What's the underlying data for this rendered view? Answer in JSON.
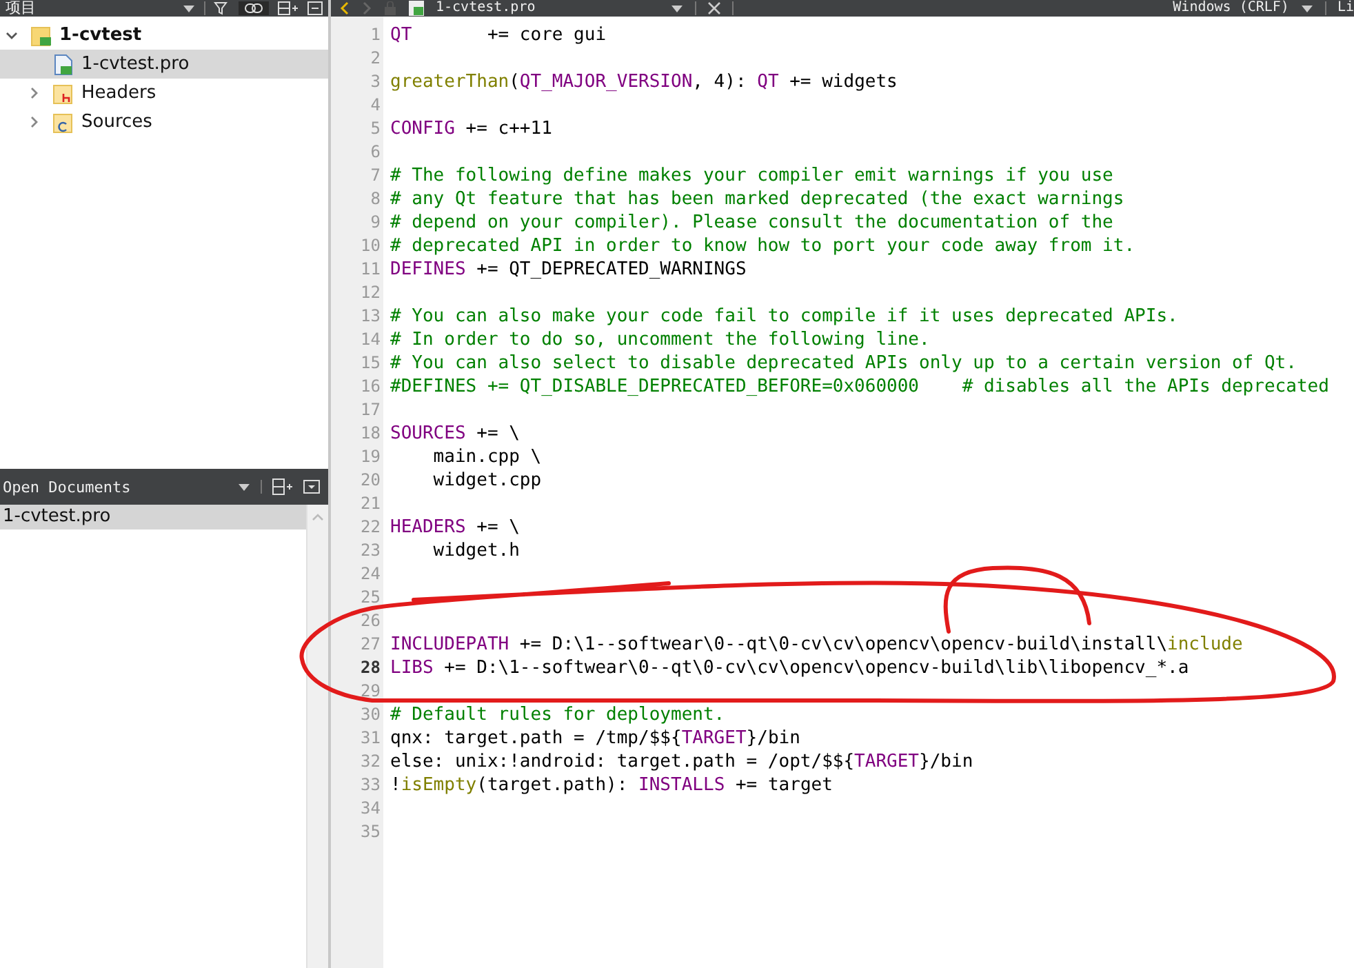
{
  "sidebar": {
    "title": "项目",
    "tree": [
      {
        "label": "1-cvtest",
        "kind": "project",
        "expanded": true,
        "selected": false,
        "children": [
          {
            "label": "1-cvtest.pro",
            "kind": "pro-file",
            "selected": true
          },
          {
            "label": "Headers",
            "kind": "headers",
            "expanded": false,
            "selected": false
          },
          {
            "label": "Sources",
            "kind": "sources",
            "expanded": false,
            "selected": false
          }
        ]
      }
    ]
  },
  "open_documents": {
    "title": "Open Documents",
    "items": [
      {
        "label": "1-cvtest.pro",
        "selected": true
      }
    ]
  },
  "editor": {
    "tab_title": "1-cvtest.pro",
    "line_ending": "Windows (CRLF)",
    "next_label": "Li",
    "lines": [
      {
        "number": "1",
        "current": false,
        "tokens": [
          {
            "kind": "keyword",
            "text": "QT"
          },
          {
            "kind": "plain",
            "text": "       += core gui"
          }
        ]
      },
      {
        "number": "2",
        "current": false
      },
      {
        "number": "3",
        "current": false,
        "tokens": [
          {
            "kind": "function",
            "text": "greaterThan"
          },
          {
            "kind": "plain",
            "text": "("
          },
          {
            "kind": "keyword",
            "text": "QT_MAJOR_VERSION"
          },
          {
            "kind": "plain",
            "text": ", 4): "
          },
          {
            "kind": "keyword",
            "text": "QT"
          },
          {
            "kind": "plain",
            "text": " += widgets"
          }
        ]
      },
      {
        "number": "4",
        "current": false
      },
      {
        "number": "5",
        "current": false,
        "tokens": [
          {
            "kind": "keyword",
            "text": "CONFIG"
          },
          {
            "kind": "plain",
            "text": " += c++11"
          }
        ]
      },
      {
        "number": "6",
        "current": false
      },
      {
        "number": "7",
        "current": false,
        "tokens": [
          {
            "kind": "comment",
            "text": "# The following define makes your compiler emit warnings if you use"
          }
        ]
      },
      {
        "number": "8",
        "current": false,
        "tokens": [
          {
            "kind": "comment",
            "text": "# any Qt feature that has been marked deprecated (the exact warnings"
          }
        ]
      },
      {
        "number": "9",
        "current": false,
        "tokens": [
          {
            "kind": "comment",
            "text": "# depend on your compiler). Please consult the documentation of the"
          }
        ]
      },
      {
        "number": "10",
        "current": false,
        "tokens": [
          {
            "kind": "comment",
            "text": "# deprecated API in order to know how to port your code away from it."
          }
        ]
      },
      {
        "number": "11",
        "current": false,
        "tokens": [
          {
            "kind": "keyword",
            "text": "DEFINES"
          },
          {
            "kind": "plain",
            "text": " += QT_DEPRECATED_WARNINGS"
          }
        ]
      },
      {
        "number": "12",
        "current": false
      },
      {
        "number": "13",
        "current": false,
        "tokens": [
          {
            "kind": "comment",
            "text": "# You can also make your code fail to compile if it uses deprecated APIs."
          }
        ]
      },
      {
        "number": "14",
        "current": false,
        "tokens": [
          {
            "kind": "comment",
            "text": "# In order to do so, uncomment the following line."
          }
        ]
      },
      {
        "number": "15",
        "current": false,
        "tokens": [
          {
            "kind": "comment",
            "text": "# You can also select to disable deprecated APIs only up to a certain version of Qt."
          }
        ]
      },
      {
        "number": "16",
        "current": false,
        "tokens": [
          {
            "kind": "comment",
            "text": "#DEFINES += QT_DISABLE_DEPRECATED_BEFORE=0x060000    # disables all the APIs deprecated"
          }
        ]
      },
      {
        "number": "17",
        "current": false
      },
      {
        "number": "18",
        "current": false,
        "tokens": [
          {
            "kind": "keyword",
            "text": "SOURCES"
          },
          {
            "kind": "plain",
            "text": " += \\"
          }
        ]
      },
      {
        "number": "19",
        "current": false,
        "tokens": [
          {
            "kind": "plain",
            "text": "    main.cpp \\"
          }
        ]
      },
      {
        "number": "20",
        "current": false,
        "tokens": [
          {
            "kind": "plain",
            "text": "    widget.cpp"
          }
        ]
      },
      {
        "number": "21",
        "current": false
      },
      {
        "number": "22",
        "current": false,
        "tokens": [
          {
            "kind": "keyword",
            "text": "HEADERS"
          },
          {
            "kind": "plain",
            "text": " += \\"
          }
        ]
      },
      {
        "number": "23",
        "current": false,
        "tokens": [
          {
            "kind": "plain",
            "text": "    widget.h"
          }
        ]
      },
      {
        "number": "24",
        "current": false
      },
      {
        "number": "25",
        "current": false
      },
      {
        "number": "26",
        "current": false
      },
      {
        "number": "27",
        "current": false,
        "tokens": [
          {
            "kind": "keyword",
            "text": "INCLUDEPATH"
          },
          {
            "kind": "plain",
            "text": " += D:\\1--softwear\\0--qt\\0-cv\\cv\\opencv\\opencv-build\\install\\"
          },
          {
            "kind": "function",
            "text": "include"
          }
        ]
      },
      {
        "number": "28",
        "current": true,
        "tokens": [
          {
            "kind": "keyword",
            "text": "LIBS"
          },
          {
            "kind": "plain",
            "text": " += D:\\1--softwear\\0--qt\\0-cv\\cv\\opencv\\opencv-build\\lib\\libopencv_*.a"
          }
        ]
      },
      {
        "number": "29",
        "current": false
      },
      {
        "number": "30",
        "current": false,
        "tokens": [
          {
            "kind": "comment",
            "text": "# Default rules for deployment."
          }
        ]
      },
      {
        "number": "31",
        "current": false,
        "tokens": [
          {
            "kind": "plain",
            "text": "qnx: target.path = /tmp/$${"
          },
          {
            "kind": "keyword",
            "text": "TARGET"
          },
          {
            "kind": "plain",
            "text": "}/bin"
          }
        ]
      },
      {
        "number": "32",
        "current": false,
        "tokens": [
          {
            "kind": "plain",
            "text": "else: unix:!android: target.path = /opt/$${"
          },
          {
            "kind": "keyword",
            "text": "TARGET"
          },
          {
            "kind": "plain",
            "text": "}/bin"
          }
        ]
      },
      {
        "number": "33",
        "current": false,
        "tokens": [
          {
            "kind": "plain",
            "text": "!"
          },
          {
            "kind": "function",
            "text": "isEmpty"
          },
          {
            "kind": "plain",
            "text": "(target.path): "
          },
          {
            "kind": "keyword",
            "text": "INSTALLS"
          },
          {
            "kind": "plain",
            "text": " += target"
          }
        ]
      },
      {
        "number": "34",
        "current": false
      },
      {
        "number": "35",
        "current": false
      }
    ]
  }
}
